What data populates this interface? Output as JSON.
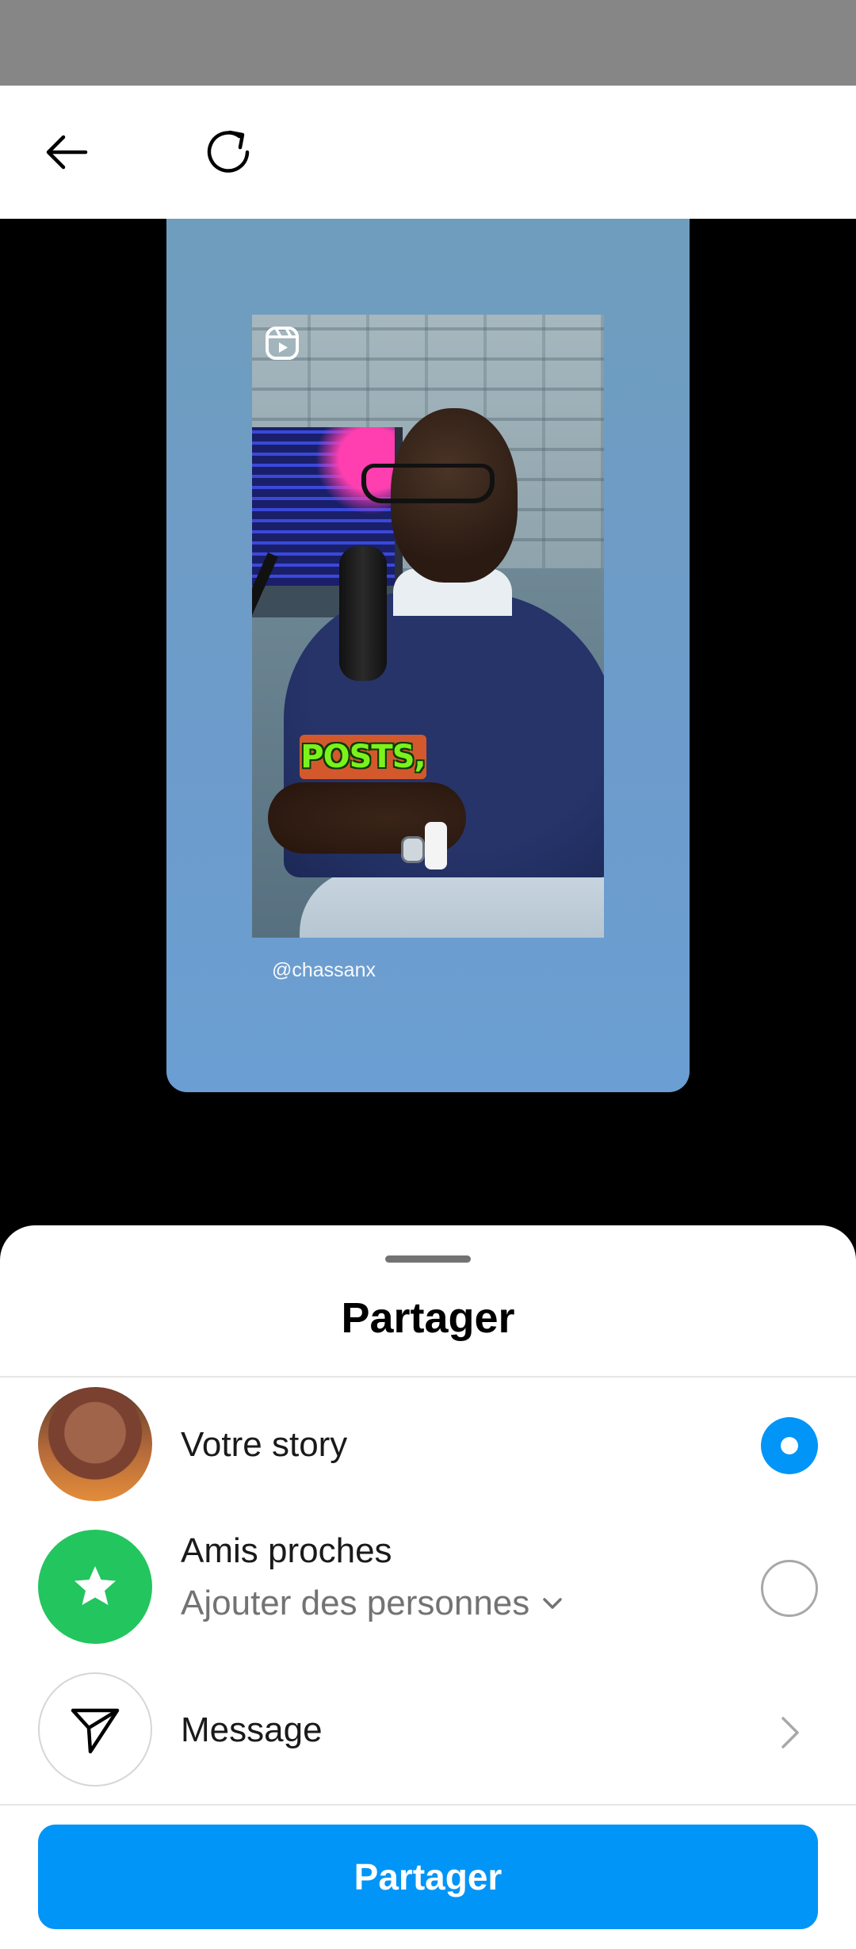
{
  "toolbar": {
    "back_icon": "arrow-left-icon",
    "refresh_icon": "refresh-icon"
  },
  "preview": {
    "reel_icon": "reels-icon",
    "caption": "POSTS,",
    "handle": "@chassanx"
  },
  "sheet": {
    "title": "Partager",
    "options": [
      {
        "label": "Votre story",
        "selected": true,
        "icon": "profile-avatar"
      },
      {
        "label": "Amis proches",
        "sublabel": "Ajouter des personnes",
        "selected": false,
        "icon": "star-icon"
      },
      {
        "label": "Message",
        "icon": "send-icon"
      }
    ],
    "primary_button": "Partager"
  },
  "colors": {
    "accent": "#0095f6",
    "close_friends": "#23c55e",
    "card": "#6d9ccc"
  }
}
